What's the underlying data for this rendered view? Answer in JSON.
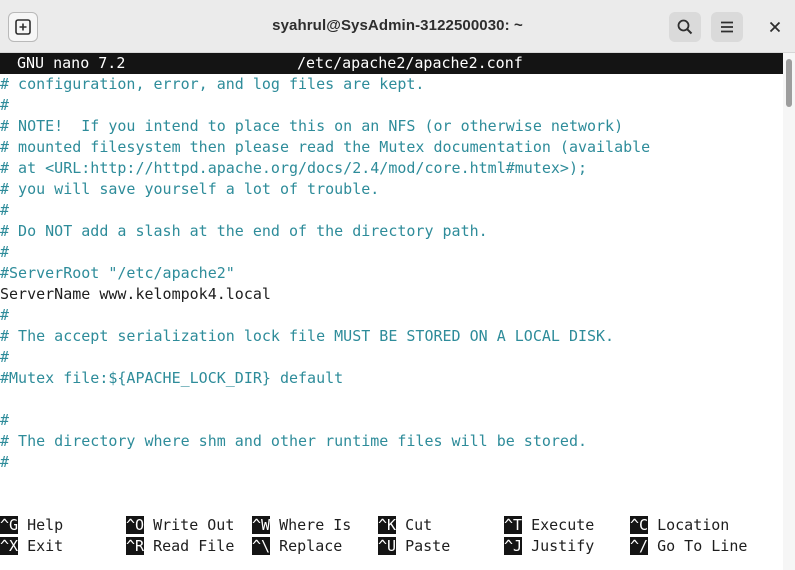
{
  "window": {
    "title": "syahrul@SysAdmin-3122500030: ~"
  },
  "header": {
    "version": "GNU nano 7.2",
    "filename": "/etc/apache2/apache2.conf"
  },
  "lines": [
    "# configuration, error, and log files are kept.",
    "#",
    "# NOTE!  If you intend to place this on an NFS (or otherwise network)",
    "# mounted filesystem then please read the Mutex documentation (available",
    "# at <URL:http://httpd.apache.org/docs/2.4/mod/core.html#mutex>);",
    "# you will save yourself a lot of trouble.",
    "#",
    "# Do NOT add a slash at the end of the directory path.",
    "#",
    "#ServerRoot \"/etc/apache2\"",
    "ServerName www.kelompok4.local",
    "#",
    "# The accept serialization lock file MUST BE STORED ON A LOCAL DISK.",
    "#",
    "#Mutex file:${APACHE_LOCK_DIR} default",
    "",
    "#",
    "# The directory where shm and other runtime files will be stored.",
    "#"
  ],
  "shortcuts": [
    {
      "key": "^G",
      "label": "Help"
    },
    {
      "key": "^O",
      "label": "Write Out"
    },
    {
      "key": "^W",
      "label": "Where Is"
    },
    {
      "key": "^K",
      "label": "Cut"
    },
    {
      "key": "^T",
      "label": "Execute"
    },
    {
      "key": "^C",
      "label": "Location"
    },
    {
      "key": "^X",
      "label": "Exit"
    },
    {
      "key": "^R",
      "label": "Read File"
    },
    {
      "key": "^\\",
      "label": "Replace"
    },
    {
      "key": "^U",
      "label": "Paste"
    },
    {
      "key": "^J",
      "label": "Justify"
    },
    {
      "key": "^/",
      "label": "Go To Line"
    }
  ],
  "icons": {
    "new_tab": "new-tab-icon",
    "search": "search-icon",
    "menu": "hamburger-menu-icon",
    "close": "close-icon"
  },
  "colors": {
    "comment": "#2e8c9a",
    "text": "#1e1e1e",
    "header_bg": "#141414",
    "titlebar_bg": "#ebebeb"
  }
}
